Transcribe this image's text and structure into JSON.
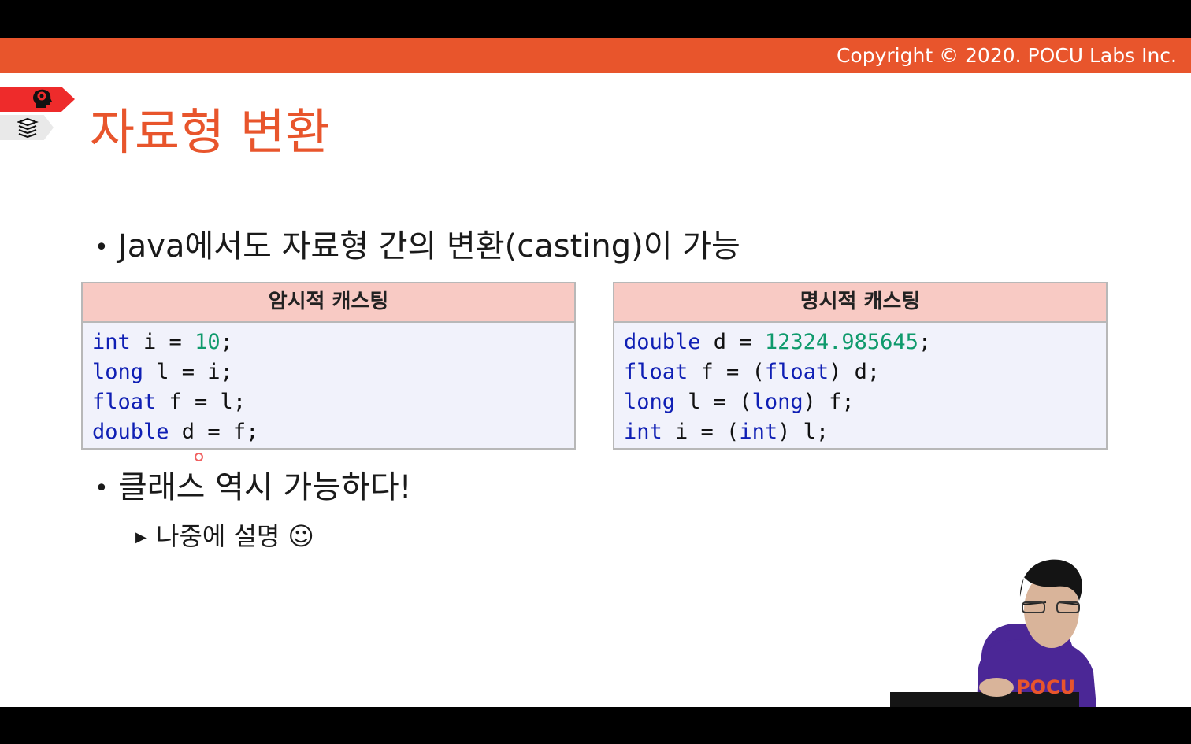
{
  "copyright": "Copyright © 2020. POCU Labs Inc.",
  "title": "자료형 변환",
  "bullets": {
    "b1": "Java에서도 자료형 간의 변환(casting)이 가능",
    "b2": "클래스 역시 가능하다!",
    "sub1": "나중에 설명 ☺"
  },
  "implicit": {
    "header": "암시적 캐스팅",
    "lines": [
      {
        "kw": "int",
        "rest1": " i = ",
        "num": "10",
        "rest2": ";"
      },
      {
        "kw": "long",
        "rest1": " l = i;"
      },
      {
        "kw": "float",
        "rest1": " f = l;"
      },
      {
        "kw": "double",
        "rest1": " d = f;"
      }
    ]
  },
  "explicit": {
    "header": "명시적 캐스팅",
    "lines": [
      {
        "kw": "double",
        "rest1": " d = ",
        "num": "12324.985645",
        "rest2": ";"
      },
      {
        "kw": "float",
        "rest1": " f = (",
        "kw2": "float",
        "rest2": ") d;"
      },
      {
        "kw": "long",
        "rest1": " l = (",
        "kw2": "long",
        "rest2": ") f;"
      },
      {
        "kw": "int",
        "rest1": " i = (",
        "kw2": "int",
        "rest2": ") l;"
      }
    ]
  },
  "presenter_shirt_text": "POCU",
  "icons": {
    "tag1": "brain-head-icon",
    "tag2": "book-stack-icon",
    "bullet": "bullet-dot-icon",
    "sub": "triangle-right-icon"
  },
  "colors": {
    "accent": "#e8552c",
    "tag_red": "#ee2b2b",
    "header_bg": "#f8cac4",
    "code_bg": "#f1f2fb",
    "keyword": "#0f1fb4",
    "number": "#0f9a6c"
  }
}
